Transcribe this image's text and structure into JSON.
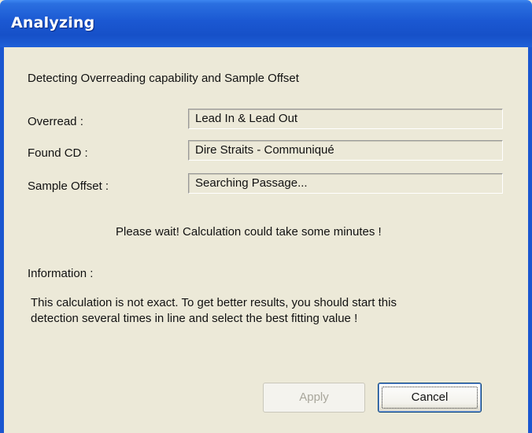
{
  "window": {
    "title": "Analyzing"
  },
  "heading": "Detecting Overreading capability and Sample Offset",
  "rows": [
    {
      "label": "Overread :",
      "value": "Lead In & Lead Out"
    },
    {
      "label": "Found CD :",
      "value": "Dire Straits - Communiqué"
    },
    {
      "label": "Sample Offset :",
      "value": "Searching Passage..."
    }
  ],
  "wait_message": "Please wait!  Calculation could take some minutes !",
  "information": {
    "label": "Information :",
    "lines": [
      "This calculation is not exact. To get better results, you should start this",
      "detection several times in line and select the best fitting value !"
    ]
  },
  "buttons": {
    "apply": "Apply",
    "cancel": "Cancel"
  },
  "colors": {
    "titlebar": "#1650c8",
    "dialog_background": "#ece9d8"
  }
}
